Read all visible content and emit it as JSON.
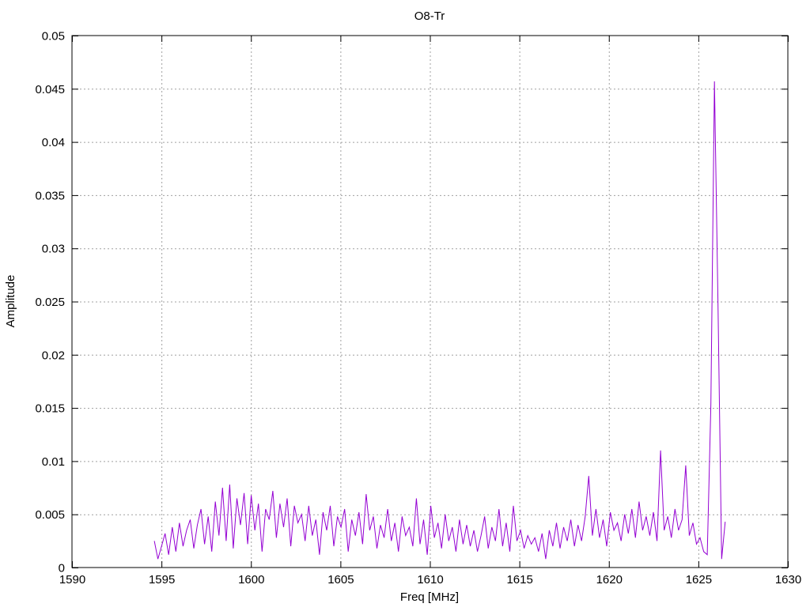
{
  "chart_data": {
    "type": "line",
    "title": "O8-Tr",
    "xlabel": "Freq [MHz]",
    "ylabel": "Amplitude",
    "xlim": [
      1590,
      1630
    ],
    "ylim": [
      0,
      0.05
    ],
    "xticks": [
      1590,
      1595,
      1600,
      1605,
      1610,
      1615,
      1620,
      1625,
      1630
    ],
    "xtick_labels": [
      "1590",
      "1595",
      "1600",
      "1605",
      "1610",
      "1615",
      "1620",
      "1625",
      "1630"
    ],
    "yticks": [
      0,
      0.005,
      0.01,
      0.015,
      0.02,
      0.025,
      0.03,
      0.035,
      0.04,
      0.045,
      0.05
    ],
    "ytick_labels": [
      "0",
      "0.005",
      "0.01",
      "0.015",
      "0.02",
      "0.025",
      "0.03",
      "0.035",
      "0.04",
      "0.045",
      "0.05"
    ],
    "grid": true,
    "legend": "none",
    "series": [
      {
        "name": "O8-Tr",
        "color": "#9400d3",
        "x_start": 1594.6,
        "x_end": 1626.5,
        "values": [
          0.0025,
          0.0008,
          0.002,
          0.0032,
          0.0012,
          0.0038,
          0.0015,
          0.0042,
          0.002,
          0.0035,
          0.0045,
          0.0018,
          0.004,
          0.0055,
          0.0022,
          0.0048,
          0.0015,
          0.0062,
          0.003,
          0.0075,
          0.0025,
          0.0078,
          0.0018,
          0.0065,
          0.004,
          0.007,
          0.0022,
          0.0068,
          0.0035,
          0.006,
          0.0015,
          0.0055,
          0.0045,
          0.0072,
          0.0028,
          0.006,
          0.0038,
          0.0065,
          0.002,
          0.0058,
          0.0042,
          0.005,
          0.0025,
          0.0058,
          0.003,
          0.0045,
          0.0012,
          0.0052,
          0.0035,
          0.0058,
          0.002,
          0.0048,
          0.0038,
          0.0055,
          0.0015,
          0.0045,
          0.003,
          0.0052,
          0.0022,
          0.0069,
          0.0035,
          0.0048,
          0.0018,
          0.004,
          0.0028,
          0.0055,
          0.0025,
          0.0042,
          0.0015,
          0.0048,
          0.003,
          0.0038,
          0.002,
          0.0065,
          0.0022,
          0.0045,
          0.0012,
          0.0058,
          0.0028,
          0.0042,
          0.0018,
          0.005,
          0.0025,
          0.0038,
          0.0015,
          0.0045,
          0.0022,
          0.004,
          0.002,
          0.0035,
          0.0015,
          0.003,
          0.0048,
          0.0018,
          0.0038,
          0.0025,
          0.0055,
          0.002,
          0.0042,
          0.0015,
          0.0058,
          0.0025,
          0.0035,
          0.0018,
          0.003,
          0.0022,
          0.0028,
          0.0015,
          0.0032,
          0.0008,
          0.0035,
          0.002,
          0.0042,
          0.0018,
          0.0038,
          0.0025,
          0.0045,
          0.002,
          0.004,
          0.0025,
          0.0048,
          0.0086,
          0.003,
          0.0055,
          0.0028,
          0.0045,
          0.002,
          0.0052,
          0.0035,
          0.0042,
          0.0025,
          0.005,
          0.0032,
          0.0055,
          0.0028,
          0.0062,
          0.0035,
          0.0048,
          0.003,
          0.0052,
          0.0025,
          0.011,
          0.0035,
          0.0048,
          0.0028,
          0.0055,
          0.0035,
          0.0045,
          0.0096,
          0.003,
          0.0042,
          0.0022,
          0.0028,
          0.0015,
          0.0012,
          0.0154,
          0.0457,
          0.0247,
          0.0008,
          0.0043
        ]
      }
    ]
  }
}
